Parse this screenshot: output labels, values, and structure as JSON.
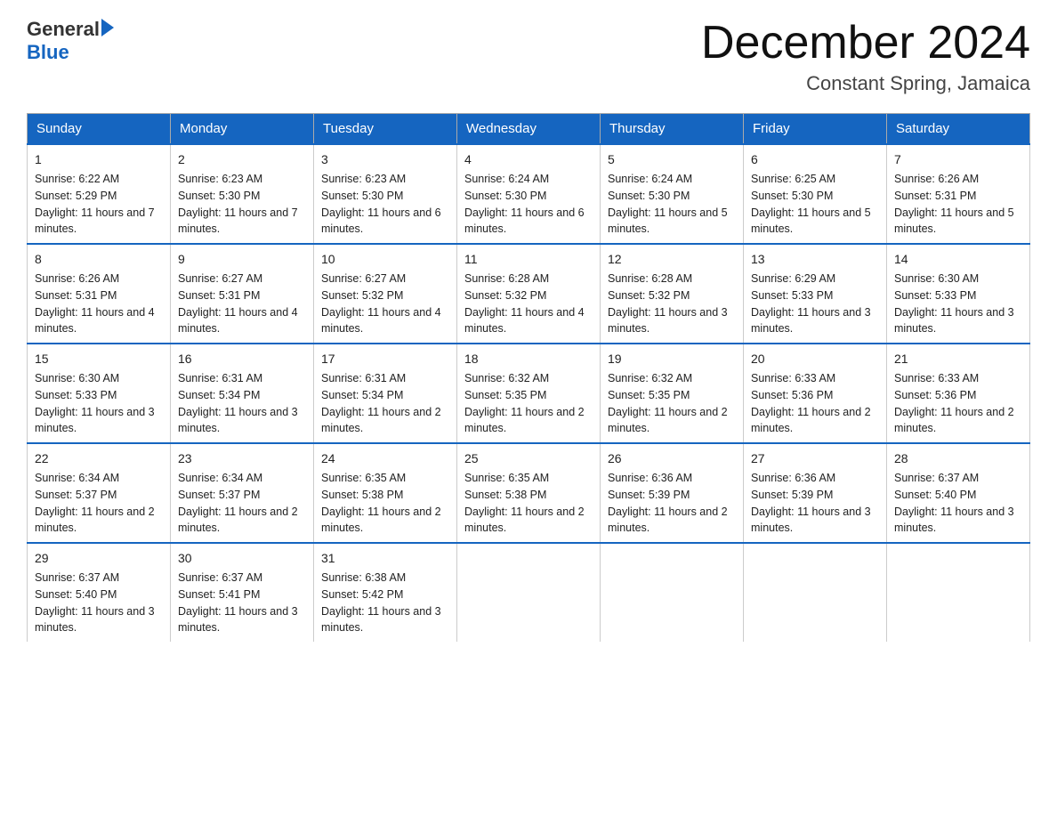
{
  "header": {
    "logo_text_general": "General",
    "logo_text_blue": "Blue",
    "month_title": "December 2024",
    "location": "Constant Spring, Jamaica"
  },
  "days_of_week": [
    "Sunday",
    "Monday",
    "Tuesday",
    "Wednesday",
    "Thursday",
    "Friday",
    "Saturday"
  ],
  "weeks": [
    [
      {
        "day": "1",
        "sunrise": "6:22 AM",
        "sunset": "5:29 PM",
        "daylight": "11 hours and 7 minutes."
      },
      {
        "day": "2",
        "sunrise": "6:23 AM",
        "sunset": "5:30 PM",
        "daylight": "11 hours and 7 minutes."
      },
      {
        "day": "3",
        "sunrise": "6:23 AM",
        "sunset": "5:30 PM",
        "daylight": "11 hours and 6 minutes."
      },
      {
        "day": "4",
        "sunrise": "6:24 AM",
        "sunset": "5:30 PM",
        "daylight": "11 hours and 6 minutes."
      },
      {
        "day": "5",
        "sunrise": "6:24 AM",
        "sunset": "5:30 PM",
        "daylight": "11 hours and 5 minutes."
      },
      {
        "day": "6",
        "sunrise": "6:25 AM",
        "sunset": "5:30 PM",
        "daylight": "11 hours and 5 minutes."
      },
      {
        "day": "7",
        "sunrise": "6:26 AM",
        "sunset": "5:31 PM",
        "daylight": "11 hours and 5 minutes."
      }
    ],
    [
      {
        "day": "8",
        "sunrise": "6:26 AM",
        "sunset": "5:31 PM",
        "daylight": "11 hours and 4 minutes."
      },
      {
        "day": "9",
        "sunrise": "6:27 AM",
        "sunset": "5:31 PM",
        "daylight": "11 hours and 4 minutes."
      },
      {
        "day": "10",
        "sunrise": "6:27 AM",
        "sunset": "5:32 PM",
        "daylight": "11 hours and 4 minutes."
      },
      {
        "day": "11",
        "sunrise": "6:28 AM",
        "sunset": "5:32 PM",
        "daylight": "11 hours and 4 minutes."
      },
      {
        "day": "12",
        "sunrise": "6:28 AM",
        "sunset": "5:32 PM",
        "daylight": "11 hours and 3 minutes."
      },
      {
        "day": "13",
        "sunrise": "6:29 AM",
        "sunset": "5:33 PM",
        "daylight": "11 hours and 3 minutes."
      },
      {
        "day": "14",
        "sunrise": "6:30 AM",
        "sunset": "5:33 PM",
        "daylight": "11 hours and 3 minutes."
      }
    ],
    [
      {
        "day": "15",
        "sunrise": "6:30 AM",
        "sunset": "5:33 PM",
        "daylight": "11 hours and 3 minutes."
      },
      {
        "day": "16",
        "sunrise": "6:31 AM",
        "sunset": "5:34 PM",
        "daylight": "11 hours and 3 minutes."
      },
      {
        "day": "17",
        "sunrise": "6:31 AM",
        "sunset": "5:34 PM",
        "daylight": "11 hours and 2 minutes."
      },
      {
        "day": "18",
        "sunrise": "6:32 AM",
        "sunset": "5:35 PM",
        "daylight": "11 hours and 2 minutes."
      },
      {
        "day": "19",
        "sunrise": "6:32 AM",
        "sunset": "5:35 PM",
        "daylight": "11 hours and 2 minutes."
      },
      {
        "day": "20",
        "sunrise": "6:33 AM",
        "sunset": "5:36 PM",
        "daylight": "11 hours and 2 minutes."
      },
      {
        "day": "21",
        "sunrise": "6:33 AM",
        "sunset": "5:36 PM",
        "daylight": "11 hours and 2 minutes."
      }
    ],
    [
      {
        "day": "22",
        "sunrise": "6:34 AM",
        "sunset": "5:37 PM",
        "daylight": "11 hours and 2 minutes."
      },
      {
        "day": "23",
        "sunrise": "6:34 AM",
        "sunset": "5:37 PM",
        "daylight": "11 hours and 2 minutes."
      },
      {
        "day": "24",
        "sunrise": "6:35 AM",
        "sunset": "5:38 PM",
        "daylight": "11 hours and 2 minutes."
      },
      {
        "day": "25",
        "sunrise": "6:35 AM",
        "sunset": "5:38 PM",
        "daylight": "11 hours and 2 minutes."
      },
      {
        "day": "26",
        "sunrise": "6:36 AM",
        "sunset": "5:39 PM",
        "daylight": "11 hours and 2 minutes."
      },
      {
        "day": "27",
        "sunrise": "6:36 AM",
        "sunset": "5:39 PM",
        "daylight": "11 hours and 3 minutes."
      },
      {
        "day": "28",
        "sunrise": "6:37 AM",
        "sunset": "5:40 PM",
        "daylight": "11 hours and 3 minutes."
      }
    ],
    [
      {
        "day": "29",
        "sunrise": "6:37 AM",
        "sunset": "5:40 PM",
        "daylight": "11 hours and 3 minutes."
      },
      {
        "day": "30",
        "sunrise": "6:37 AM",
        "sunset": "5:41 PM",
        "daylight": "11 hours and 3 minutes."
      },
      {
        "day": "31",
        "sunrise": "6:38 AM",
        "sunset": "5:42 PM",
        "daylight": "11 hours and 3 minutes."
      },
      null,
      null,
      null,
      null
    ]
  ],
  "labels": {
    "sunrise": "Sunrise: ",
    "sunset": "Sunset: ",
    "daylight": "Daylight: "
  }
}
